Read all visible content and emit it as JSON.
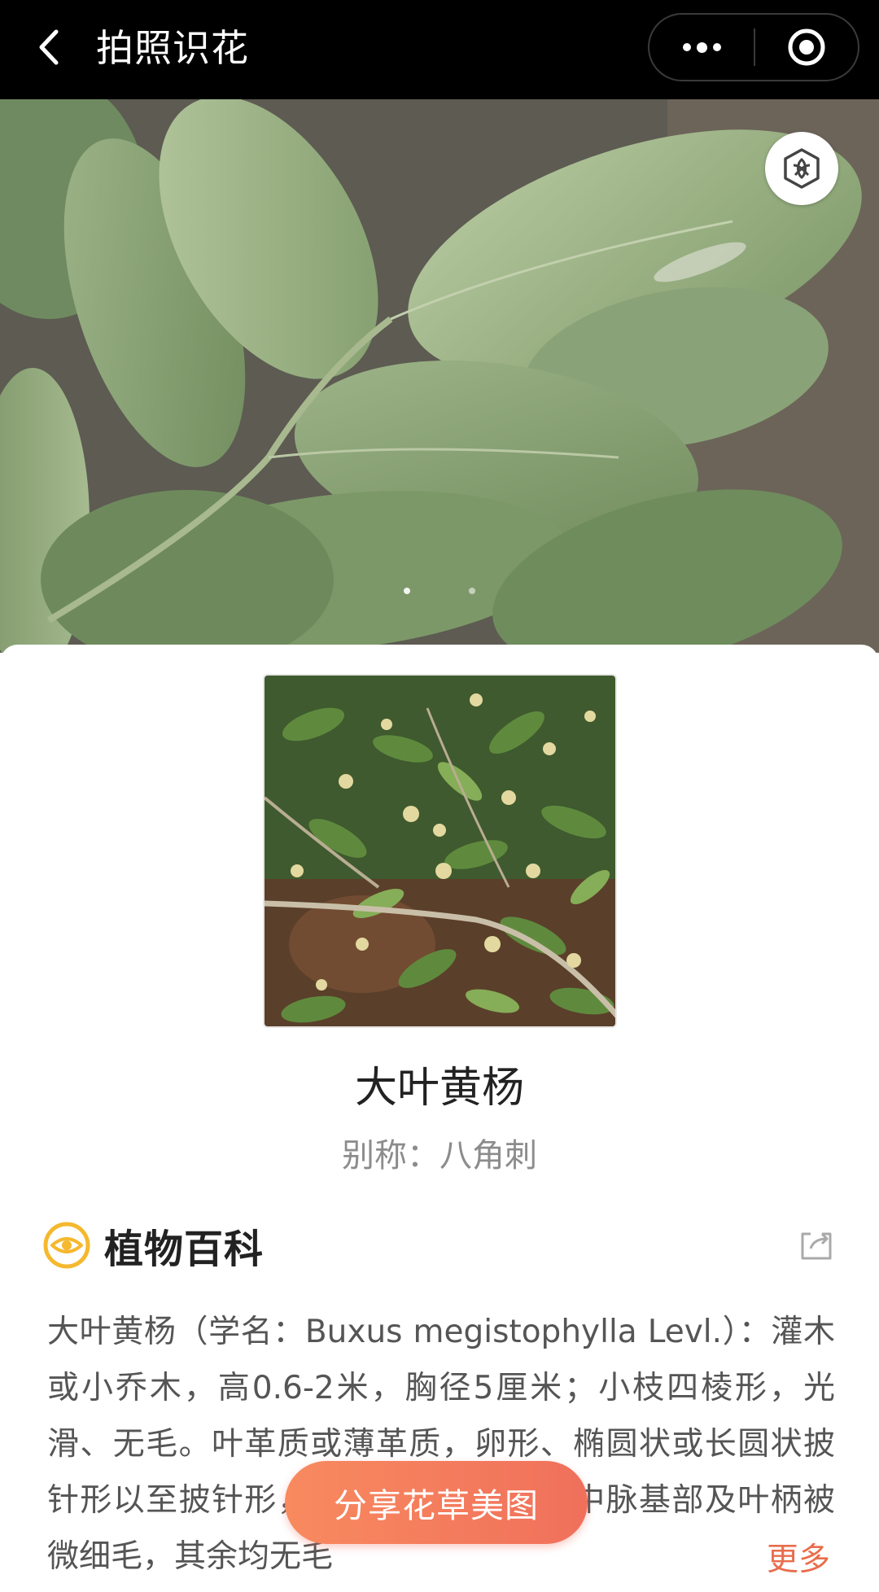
{
  "topbar": {
    "title": "拍照识花",
    "back_icon": "chevron-left-icon",
    "more_icon": "ellipsis-icon",
    "close_icon": "target-circle-icon"
  },
  "hero": {
    "badge_icon": "flower-hexagon-icon",
    "carousel_pages": 2,
    "carousel_active": 1
  },
  "plant": {
    "name": "大叶黄杨",
    "alias_label": "别称：",
    "alias": "八角刺"
  },
  "encyclopedia": {
    "title": "植物百科",
    "icon": "eye-icon",
    "share_icon": "share-icon",
    "description": "大叶黄杨（学名：Buxus megistophylla Levl.）：灌木或小乔木，高0.6-2米，胸径5厘米；小枝四棱形，光滑、无毛。叶革质或薄革质，卵形、椭圆状或长圆状披针形以至披针形，叶面光亮，仅叶面中脉基部及叶柄被微细毛，其余均无毛",
    "more_label": "更多"
  },
  "share_button": {
    "label": "分享花草美图"
  },
  "colors": {
    "topbar_bg": "#000000",
    "accent": "#f0705b",
    "icon_yellow": "#f5b82e",
    "more_link": "#e96d4c"
  }
}
